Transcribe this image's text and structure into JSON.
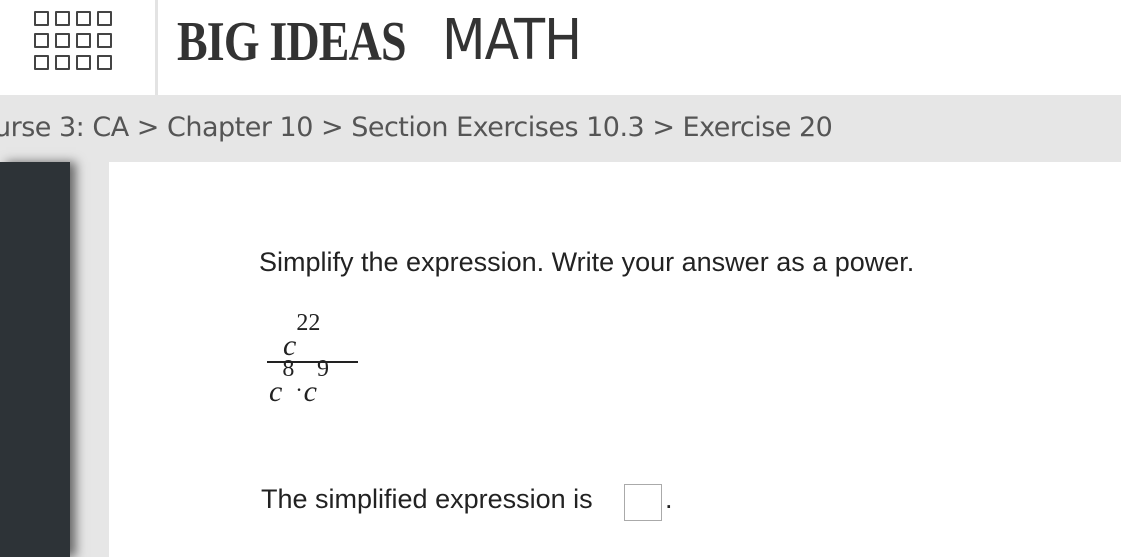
{
  "header": {
    "brand_bold": "BIG IDEAS",
    "brand_light": "MATH",
    "menu_icon": "grid-menu-icon"
  },
  "breadcrumb": [
    {
      "label": "ourse 3: CA"
    },
    {
      "label": "Chapter 10"
    },
    {
      "label": "Section Exercises 10.3"
    },
    {
      "label": "Exercise 20"
    }
  ],
  "breadcrumb_separator": ">",
  "exercise": {
    "prompt": "Simplify the expression. Write your answer as a power.",
    "numerator_base": "c",
    "numerator_exp": "22",
    "denominator_base1": "c",
    "denominator_exp1": "8",
    "denominator_op": "·",
    "denominator_base2": "c",
    "denominator_exp2": "9",
    "answer_label": "The simplified expression is",
    "answer_value": "",
    "answer_period": "."
  }
}
